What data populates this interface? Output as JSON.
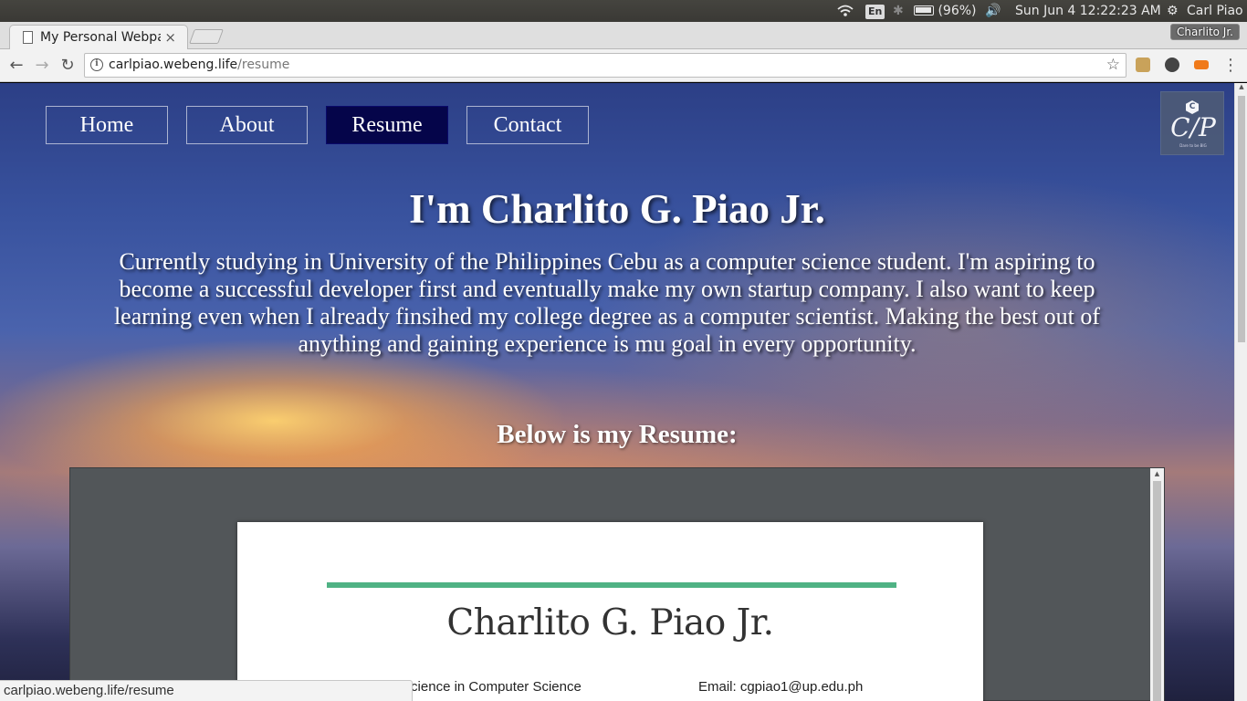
{
  "os_panel": {
    "language": "En",
    "battery": "(96%)",
    "clock": "Sun Jun  4 12:22:23 AM",
    "user": "Carl Piao"
  },
  "browser": {
    "tab_title": "My Personal Webpage",
    "tab_close": "×",
    "profile": "Charlito Jr.",
    "url_domain": "carlpiao.webeng.life",
    "url_path": "/resume",
    "back": "←",
    "forward": "→",
    "reload": "↻",
    "star": "☆",
    "menu": "⋮",
    "status_url": "carlpiao.webeng.life/resume"
  },
  "site": {
    "nav": {
      "home": "Home",
      "about": "About",
      "resume": "Resume",
      "contact": "Contact"
    },
    "logo": {
      "letter": "C",
      "monogram": "C/P",
      "tagline": "Dare to be BIG"
    },
    "title": "I'm Charlito G. Piao Jr.",
    "description": "Currently studying in University of the Philippines Cebu as a computer science student. I'm aspiring to become a successful developer first and eventually make my own startup company. I also want to keep learning even when I already finsihed my college degree as a computer scientist. Making the best out of anything and gaining experience is mu goal in every opportunity.",
    "resume_heading": "Below is my Resume:"
  },
  "resume_pdf": {
    "name": "Charlito G. Piao Jr.",
    "degree": "Bachelor of Science in Computer Science",
    "email": "Email: cgpiao1@up.edu.ph"
  },
  "colors": {
    "active_nav": "#05054a",
    "accent_rule": "#4fb284"
  }
}
